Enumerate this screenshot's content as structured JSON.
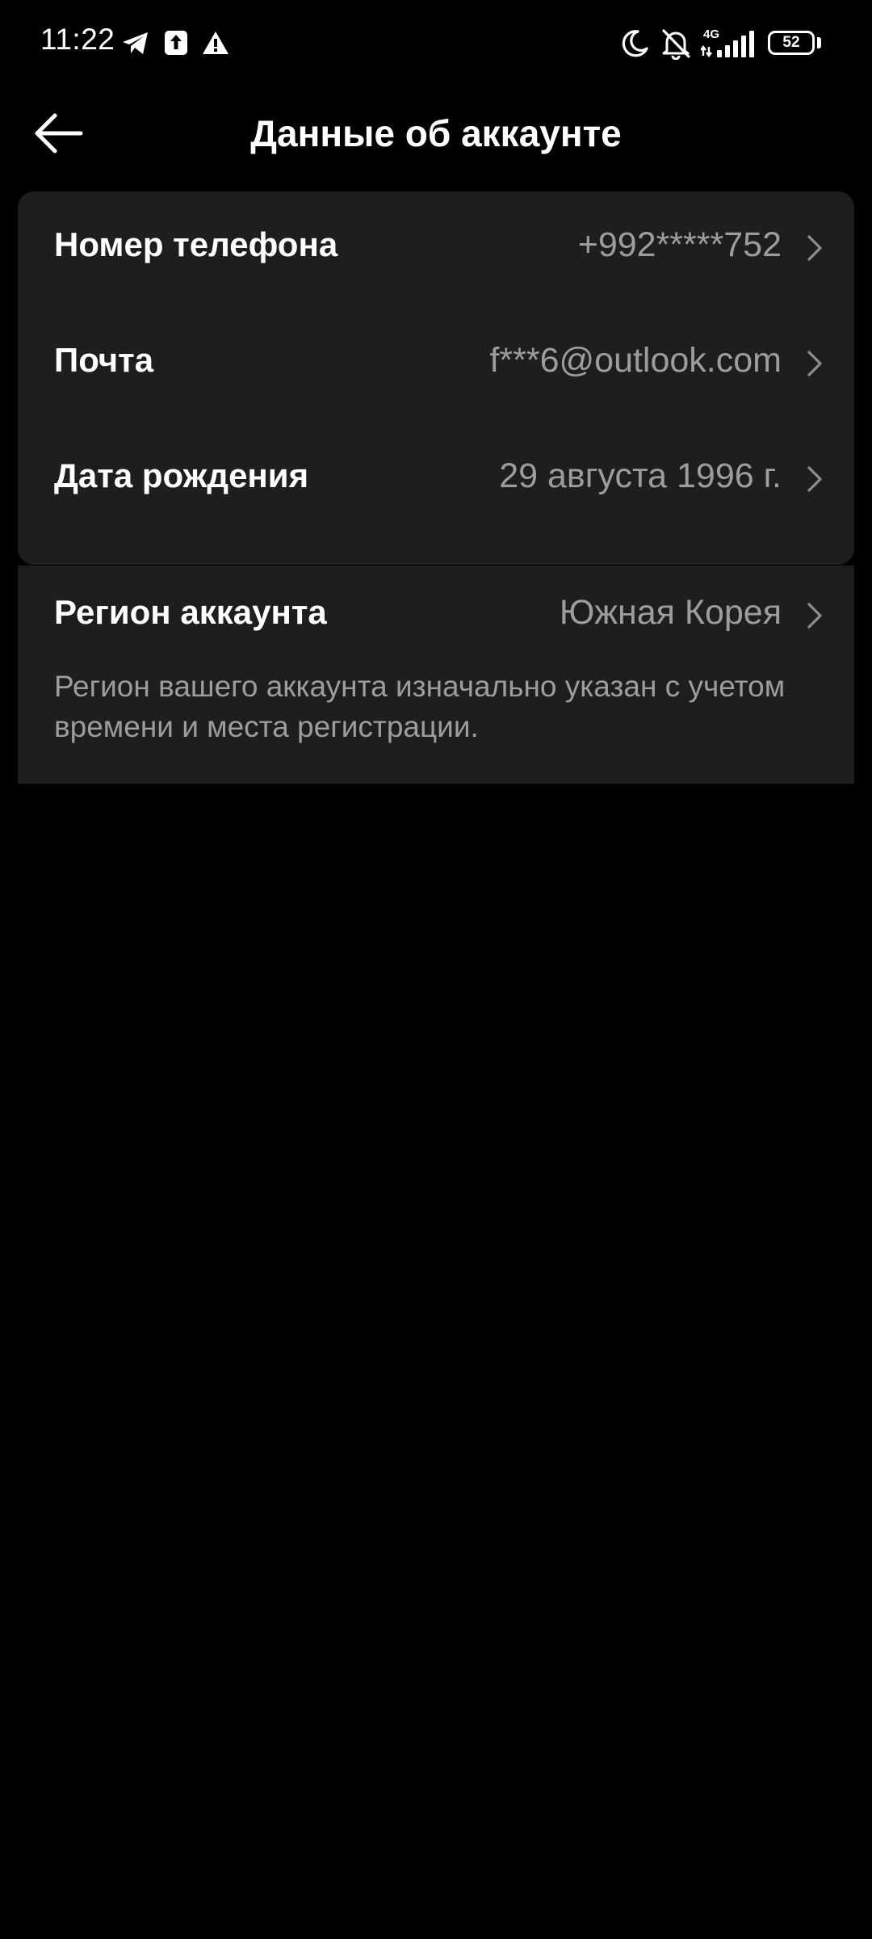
{
  "status_bar": {
    "time": "11:22",
    "network": "4G",
    "battery": "52",
    "icons": [
      "telegram-icon",
      "upload-icon",
      "warning-icon",
      "moon-icon",
      "bell-off-icon",
      "signal-icon",
      "battery-icon"
    ]
  },
  "header": {
    "title": "Данные об аккаунте",
    "back_icon": "arrow-left-icon"
  },
  "account_details": [
    {
      "label": "Номер телефона",
      "value": "+992*****752"
    },
    {
      "label": "Почта",
      "value": "f***6@outlook.com"
    },
    {
      "label": "Дата рождения",
      "value": "29 августа 1996 г."
    }
  ],
  "region": {
    "label": "Регион аккаунта",
    "value": "Южная Корея",
    "note": "Регион вашего аккаунта изначально указан с учетом времени и места регистрации."
  },
  "colors": {
    "background": "#000000",
    "card": "#1e1e1f",
    "primary_text": "#ffffff",
    "secondary_text": "#9d9d9f"
  }
}
